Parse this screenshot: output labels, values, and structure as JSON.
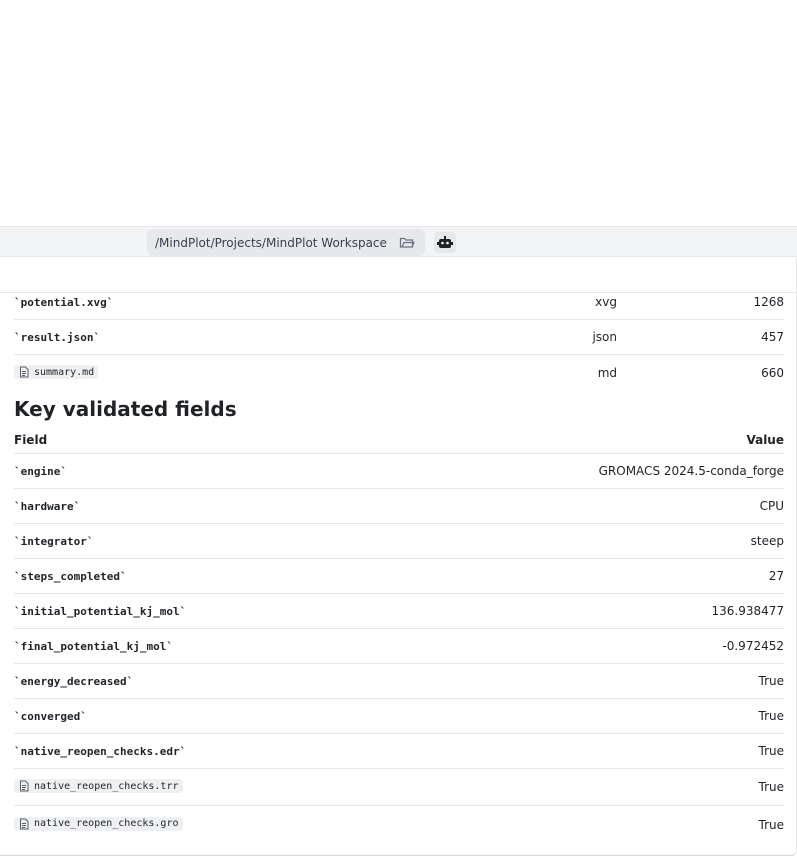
{
  "toolbar": {
    "path": "/MindPlot/Projects/MindPlot Workspace"
  },
  "files": [
    {
      "name": "`potential.xvg`",
      "type": "xvg",
      "size": "1268",
      "chip": false
    },
    {
      "name": "`result.json`",
      "type": "json",
      "size": "457",
      "chip": false
    },
    {
      "name": "summary.md",
      "type": "md",
      "size": "660",
      "chip": true
    }
  ],
  "section": {
    "title": "Key validated fields",
    "col_field": "Field",
    "col_value": "Value"
  },
  "fields": [
    {
      "name": "`engine`",
      "value": "GROMACS 2024.5-conda_forge",
      "chip": false
    },
    {
      "name": "`hardware`",
      "value": "CPU",
      "chip": false
    },
    {
      "name": "`integrator`",
      "value": "steep",
      "chip": false
    },
    {
      "name": "`steps_completed`",
      "value": "27",
      "chip": false
    },
    {
      "name": "`initial_potential_kj_mol`",
      "value": "136.938477",
      "chip": false
    },
    {
      "name": "`final_potential_kj_mol`",
      "value": "-0.972452",
      "chip": false
    },
    {
      "name": "`energy_decreased`",
      "value": "True",
      "chip": false
    },
    {
      "name": "`converged`",
      "value": "True",
      "chip": false
    },
    {
      "name": "`native_reopen_checks.edr`",
      "value": "True",
      "chip": false
    },
    {
      "name": "native_reopen_checks.trr",
      "value": "True",
      "chip": true
    },
    {
      "name": "native_reopen_checks.gro",
      "value": "True",
      "chip": true
    }
  ]
}
